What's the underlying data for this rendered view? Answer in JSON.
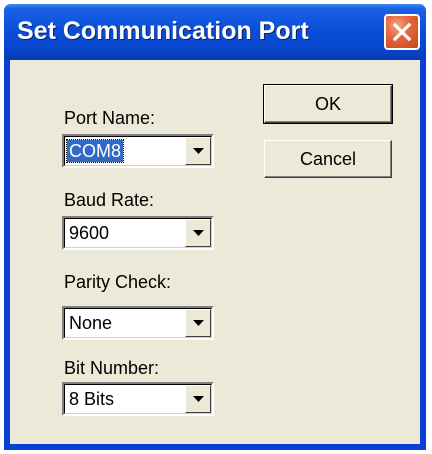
{
  "window": {
    "title": "Set Communication Port"
  },
  "buttons": {
    "ok_label": "OK",
    "cancel_label": "Cancel"
  },
  "fields": {
    "port_name": {
      "label": "Port Name:",
      "value": "COM8"
    },
    "baud_rate": {
      "label": "Baud Rate:",
      "value": "9600"
    },
    "parity_check": {
      "label": "Parity Check:",
      "value": "None"
    },
    "bit_number": {
      "label": "Bit Number:",
      "value": "8 Bits"
    }
  },
  "icons": {
    "close": "close-icon",
    "dropdown": "chevron-down-icon"
  },
  "colors": {
    "titlebar": "#0a4fd8",
    "client_background": "#ece9d8",
    "close_button": "#e5683e",
    "selection": "#316ac5"
  }
}
